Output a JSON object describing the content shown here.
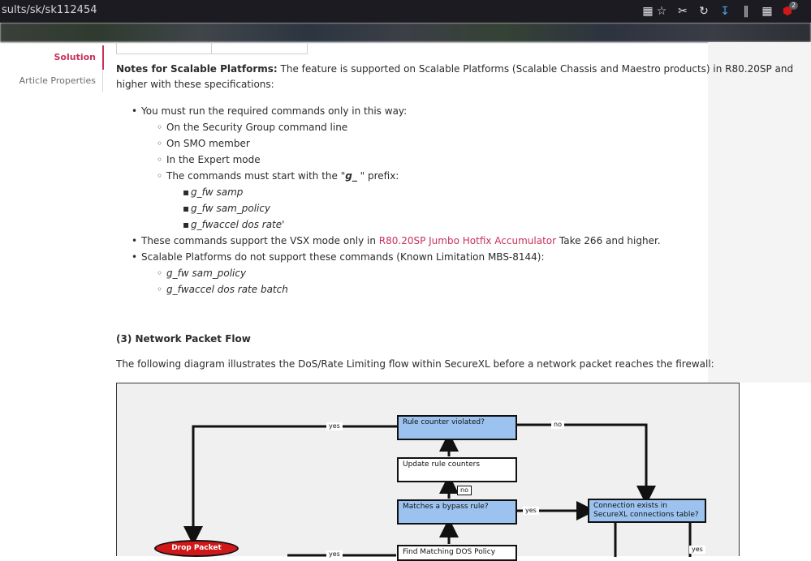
{
  "browser": {
    "url_text": "sults/sk/sk112454",
    "badge_count": "2"
  },
  "sidebar": {
    "items": [
      {
        "label": "Solution",
        "active": true
      },
      {
        "label": "Article Properties",
        "active": false
      }
    ]
  },
  "notes": {
    "heading": "Notes for Scalable Platforms:",
    "intro_line1": " The feature is supported on Scalable Platforms (Scalable Chassis and Maestro products) in R80.20SP and",
    "intro_line2": "higher with these specifications:",
    "bullet1": "You must run the required commands only in this way:",
    "sub1": "On the Security Group command line",
    "sub2": "On SMO member",
    "sub3": "In the Expert mode",
    "sub4_pre": "The commands must start with the \"",
    "sub4_code": "g_",
    "sub4_post": " \" prefix:",
    "cmd1": "g_fw samp",
    "cmd2": "g_fw sam_policy",
    "cmd3": "g_fwaccel dos rate'",
    "bullet2_pre": "These commands support the VSX mode only in ",
    "bullet2_link": "R80.20SP Jumbo Hotfix Accumulator",
    "bullet2_post": " Take 266 and higher.",
    "bullet3": "Scalable Platforms do not support these commands (Known Limitation MBS-8144):",
    "unsup1": "g_fw sam_policy",
    "unsup2": "g_fwaccel dos rate batch"
  },
  "section3": {
    "title": "(3) Network Packet Flow",
    "description": "The following diagram illustrates the DoS/Rate Limiting flow within SecureXL before a network packet reaches the firewall:"
  },
  "diagram": {
    "box_rule_counter": "Rule counter violated?",
    "box_update": "Update rule counters",
    "box_bypass": "Matches a bypass rule?",
    "box_connection": "Connection exists in SecureXL connections table?",
    "box_find_policy": "Find Matching DOS Policy",
    "oval_drop": "Drop Packet",
    "tag_yes_top": "yes",
    "tag_no_top": "no",
    "tag_no_mid": "no",
    "tag_yes_mid": "yes",
    "tag_yes_bottom": "yes",
    "tag_yes_right": "yes"
  },
  "colors": {
    "accent": "#c8325a",
    "diagram_box": "#9cc3f0",
    "drop_oval": "#d01818"
  }
}
